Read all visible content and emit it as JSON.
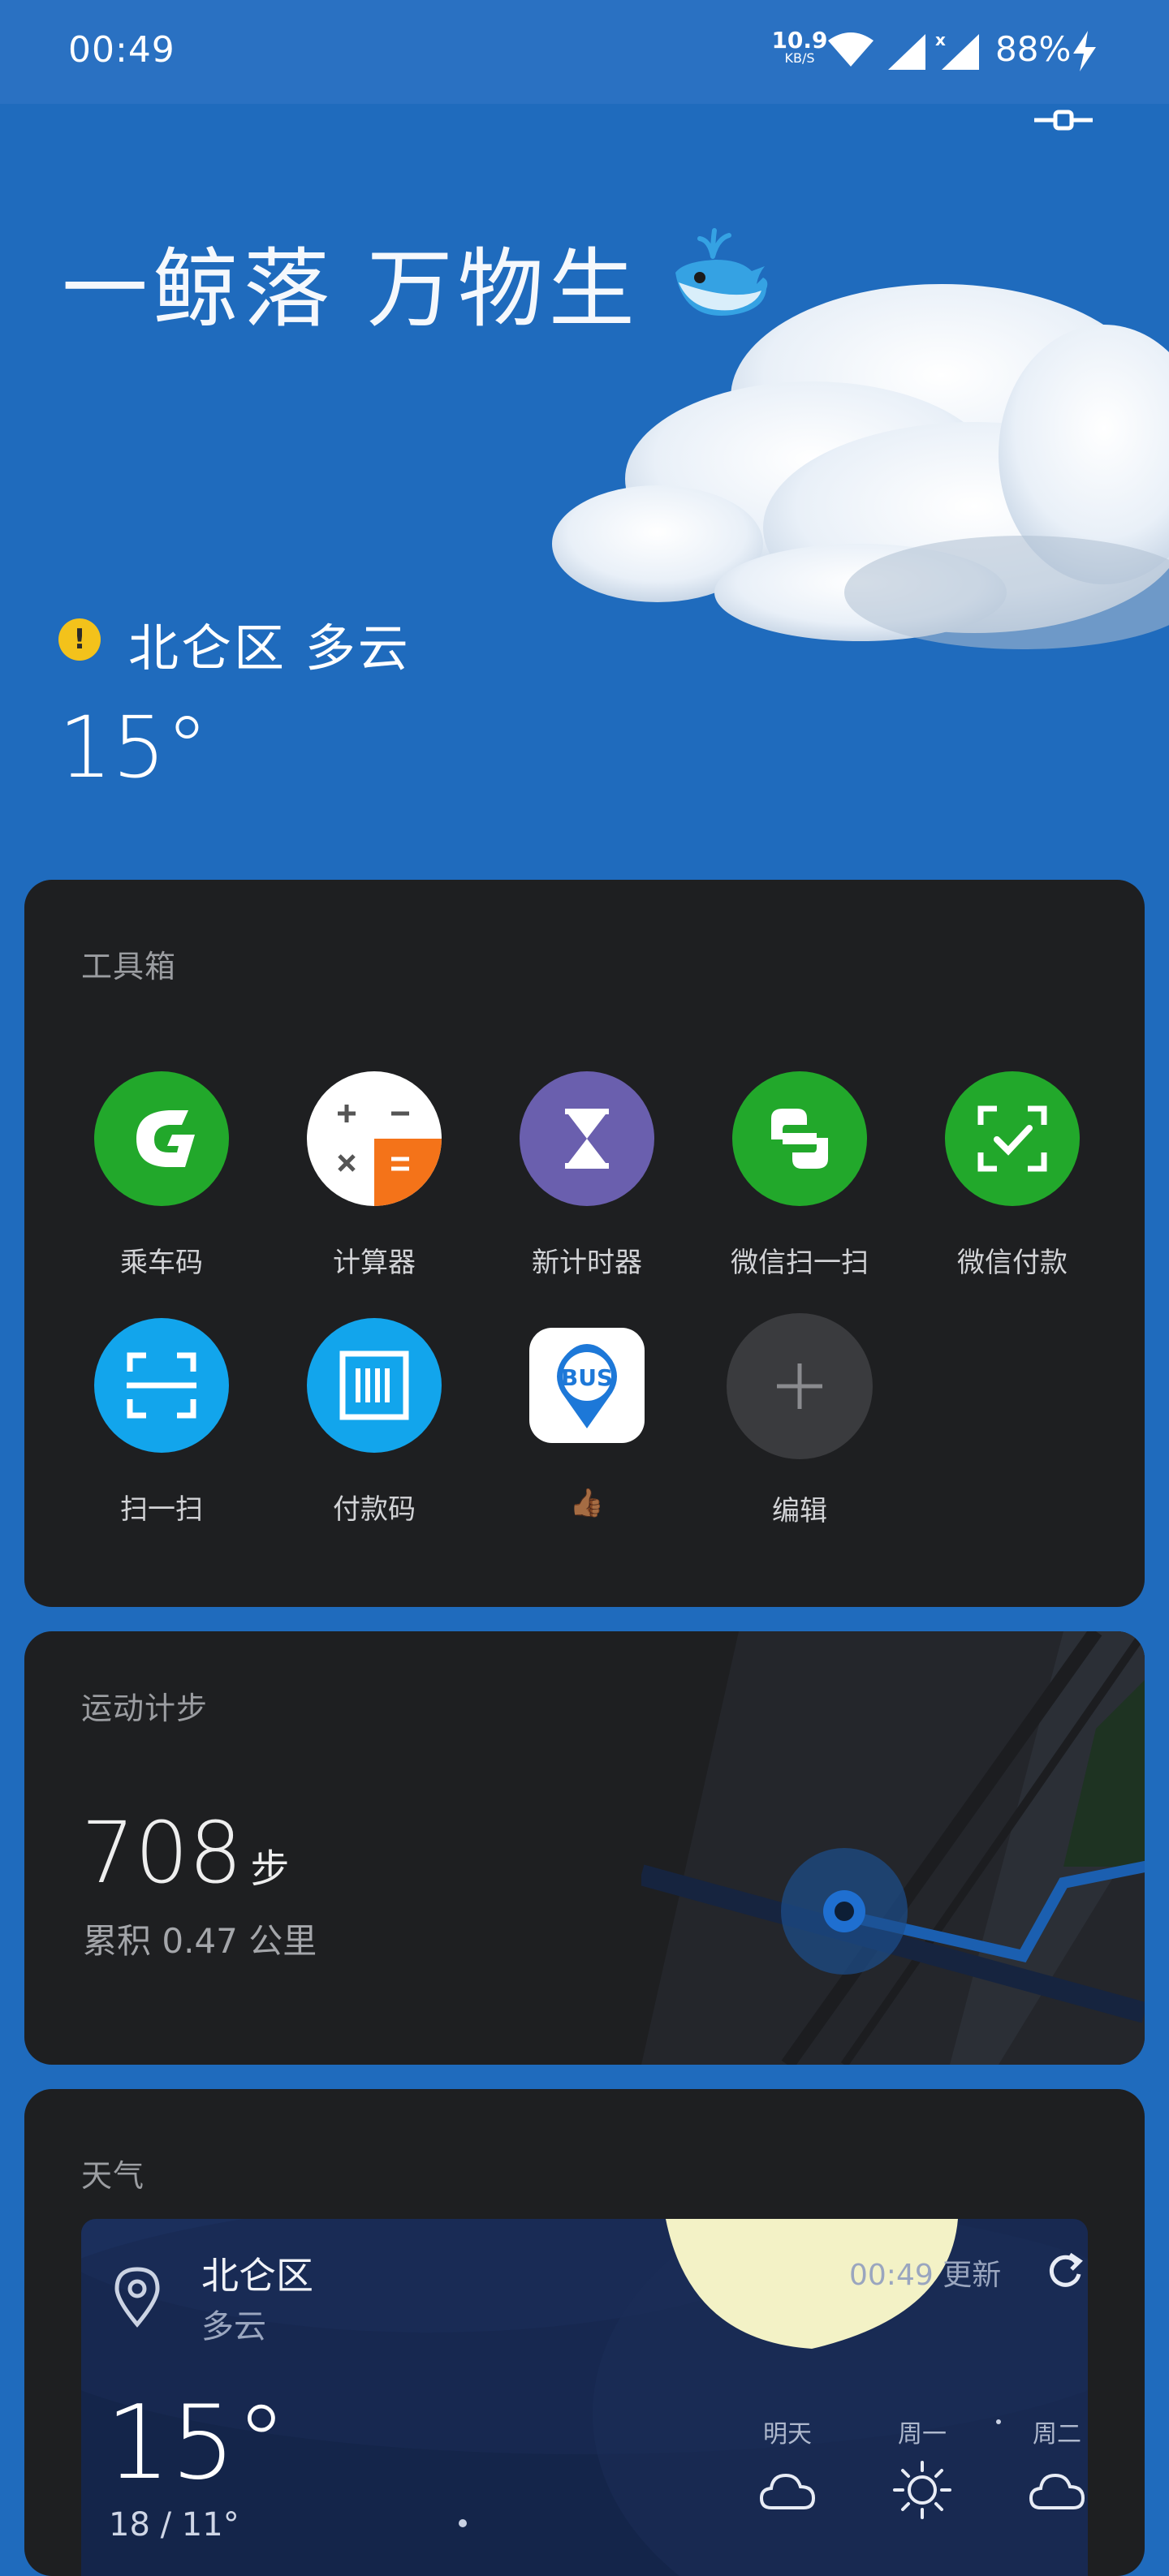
{
  "status_bar": {
    "time": "00:49",
    "net_speed": "10.9",
    "net_unit": "KB/S",
    "battery": "88%",
    "icons": [
      "wifi-icon",
      "signal-icon",
      "signal-no-data-icon",
      "charging-icon"
    ]
  },
  "hero": {
    "title": "一鲸落 万物生",
    "location_weather": "北仑区  多云",
    "temperature": "15°",
    "warning_icon": "!"
  },
  "toolbox": {
    "title": "工具箱",
    "tools": [
      {
        "label": "乘车码",
        "icon": "bus-code-icon",
        "color": "#22a82b"
      },
      {
        "label": "计算器",
        "icon": "calculator-icon",
        "color": "#ffffff"
      },
      {
        "label": "新计时器",
        "icon": "hourglass-icon",
        "color": "#6a5fae"
      },
      {
        "label": "微信扫一扫",
        "icon": "wechat-scan-icon",
        "color": "#22a82b"
      },
      {
        "label": "微信付款",
        "icon": "wechat-pay-icon",
        "color": "#22a82b"
      },
      {
        "label": "扫一扫",
        "icon": "scan-icon",
        "color": "#12a5ec"
      },
      {
        "label": "付款码",
        "icon": "payment-code-icon",
        "color": "#12a5ec"
      },
      {
        "label": "👍🏾",
        "icon": "bus-app-icon",
        "color": "#ffffff"
      },
      {
        "label": "编辑",
        "icon": "add-icon",
        "color": "#3a3b3e"
      }
    ],
    "bus_badge": "BUS"
  },
  "steps": {
    "title": "运动计步",
    "count": "708",
    "unit": "步",
    "distance": "累积 0.47 公里"
  },
  "weather": {
    "title": "天气",
    "location": "北仑区",
    "condition": "多云",
    "updated": "00:49 更新",
    "temperature": "15°",
    "range": "18 / 11°",
    "forecast": [
      {
        "day": "明天",
        "icon": "cloud-icon"
      },
      {
        "day": "周一",
        "icon": "sun-icon"
      },
      {
        "day": "周二",
        "icon": "cloud-icon"
      }
    ]
  }
}
